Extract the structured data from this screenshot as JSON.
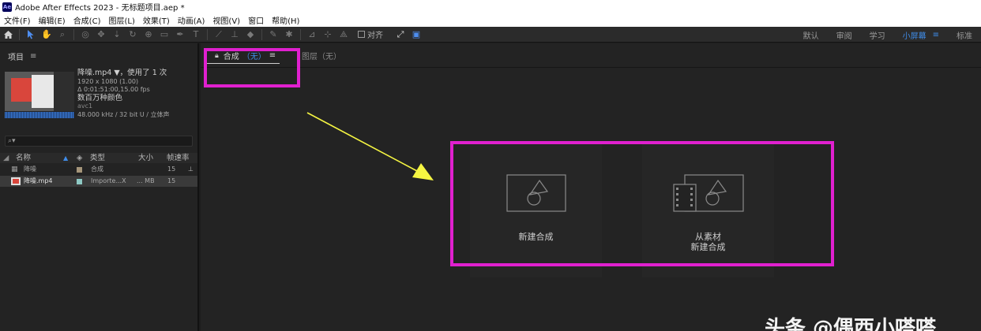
{
  "titlebar": {
    "logo": "Ae",
    "title": "Adobe After Effects 2023 - 无标题项目.aep *"
  },
  "menu": [
    "文件(F)",
    "编辑(E)",
    "合成(C)",
    "图层(L)",
    "效果(T)",
    "动画(A)",
    "视图(V)",
    "窗口",
    "帮助(H)"
  ],
  "toolbar": {
    "snap_label": "对齐"
  },
  "workspaces": [
    "默认",
    "审阅",
    "学习",
    "小屏幕",
    "≡",
    "标准"
  ],
  "project": {
    "title": "项目",
    "menu_glyph": "≡",
    "asset": {
      "name": "降噪.mp4 ▼，使用了 1 次",
      "resolution": "1920 x 1080 (1.00)",
      "duration": "Δ 0:01:51:00,15.00 fps",
      "colors": "数百万种颜色",
      "codec": "avc1",
      "audio": "48.000 kHz / 32 bit U / 立体声"
    },
    "search_placeholder": "⌕▾",
    "columns": {
      "name": "名称",
      "type": "类型",
      "size": "大小",
      "fps": "帧速率"
    },
    "rows": [
      {
        "name": "降噪",
        "type": "合成",
        "size": "",
        "fps": "15",
        "swatch": "#a5957a"
      },
      {
        "name": "降噪.mp4",
        "type": "Importe...X",
        "size": "... MB",
        "fps": "15",
        "swatch": "#8ec9c4"
      }
    ]
  },
  "comp": {
    "tab_label": "合成",
    "tab_value": "（无）",
    "tab_menu": "≡",
    "layer_tab": "图层（无）",
    "tiles": [
      {
        "label_line1": "新建合成",
        "label_line2": ""
      },
      {
        "label_line1": "从素材",
        "label_line2": "新建合成"
      }
    ]
  },
  "colors": {
    "highlight": "#e020cf",
    "arrow": "#f5f542",
    "accent": "#3f8ce8"
  },
  "watermark": "头条 @偶西小嗒嗒"
}
